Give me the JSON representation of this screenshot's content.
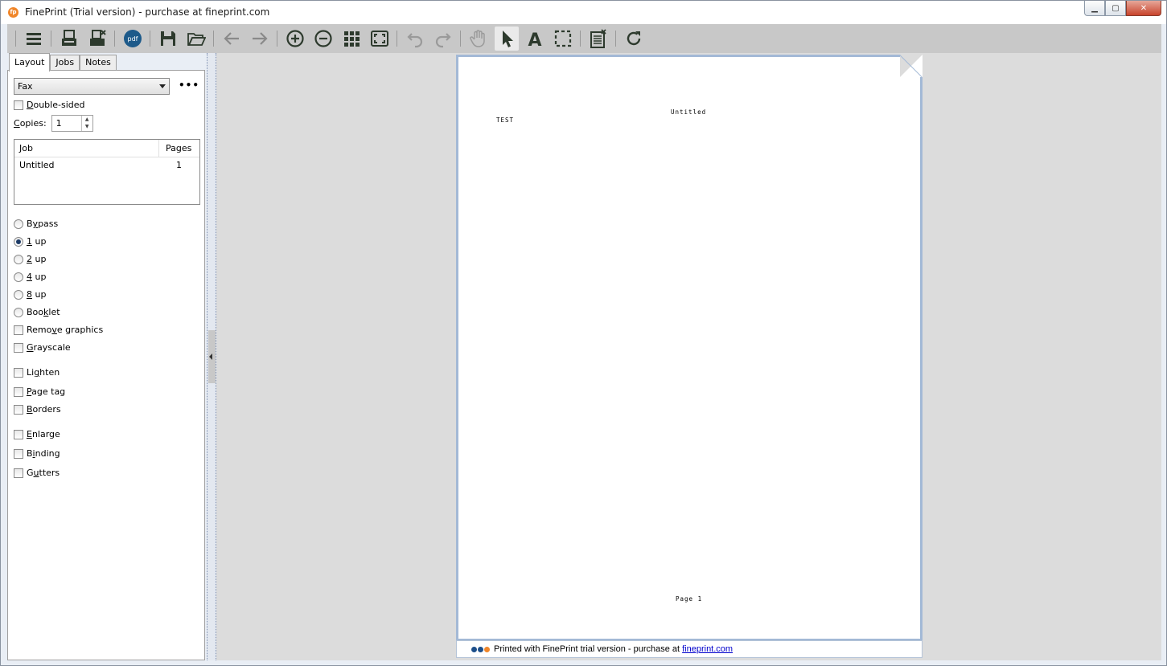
{
  "window": {
    "title": "FinePrint (Trial version) - purchase at fineprint.com",
    "app_icon_text": "fp",
    "buttons": {
      "minimize": "▭",
      "maximize": "▢",
      "close": "✕"
    }
  },
  "toolbar": {
    "items": [
      {
        "name": "menu",
        "icon": "hamburger-icon"
      },
      {
        "name": "print",
        "icon": "printer-icon"
      },
      {
        "name": "print-delete",
        "icon": "printer-delete-icon"
      },
      {
        "name": "pdf",
        "icon": "pdf-icon",
        "label": "pdf"
      },
      {
        "name": "save",
        "icon": "save-icon"
      },
      {
        "name": "open",
        "icon": "folder-open-icon"
      },
      {
        "name": "back",
        "icon": "arrow-left-icon"
      },
      {
        "name": "forward",
        "icon": "arrow-right-icon"
      },
      {
        "name": "zoom-in",
        "icon": "zoom-in-icon"
      },
      {
        "name": "zoom-out",
        "icon": "zoom-out-icon"
      },
      {
        "name": "thumbnails",
        "icon": "grid-icon"
      },
      {
        "name": "fit-page",
        "icon": "fit-icon"
      },
      {
        "name": "undo",
        "icon": "undo-icon"
      },
      {
        "name": "redo",
        "icon": "redo-icon"
      },
      {
        "name": "pan",
        "icon": "hand-icon"
      },
      {
        "name": "select",
        "icon": "pointer-icon"
      },
      {
        "name": "text",
        "icon": "text-icon"
      },
      {
        "name": "area-select",
        "icon": "marquee-icon"
      },
      {
        "name": "delete-page",
        "icon": "page-delete-icon"
      },
      {
        "name": "refresh",
        "icon": "refresh-icon"
      }
    ]
  },
  "tabs": [
    {
      "label": "Layout",
      "active": true
    },
    {
      "label": "Jobs",
      "active": false
    },
    {
      "label": "Notes",
      "active": false
    }
  ],
  "layout_panel": {
    "printer_select": "Fax",
    "more_button": "•••",
    "double_sided": {
      "label_u": "D",
      "label_rest": "ouble-sided",
      "checked": false
    },
    "copies": {
      "label_u": "C",
      "label_rest": "opies:",
      "value": "1"
    },
    "job_table": {
      "headers": [
        "Job",
        "Pages"
      ],
      "rows": [
        {
          "job": "Untitled",
          "pages": "1"
        }
      ]
    },
    "radios": [
      {
        "pre": "B",
        "u": "y",
        "post": "pass",
        "checked": false
      },
      {
        "pre": "",
        "u": "1",
        "post": " up",
        "checked": true
      },
      {
        "pre": "",
        "u": "2",
        "post": " up",
        "checked": false
      },
      {
        "pre": "",
        "u": "4",
        "post": " up",
        "checked": false
      },
      {
        "pre": "",
        "u": "8",
        "post": " up",
        "checked": false
      },
      {
        "pre": "Boo",
        "u": "k",
        "post": "let",
        "checked": false
      }
    ],
    "checkboxes": [
      {
        "pre": "Remo",
        "u": "v",
        "post": "e graphics",
        "checked": false
      },
      {
        "pre": "",
        "u": "G",
        "post": "rayscale",
        "checked": false
      },
      {
        "pre": "Li",
        "u": "g",
        "post": "hten",
        "checked": false
      },
      {
        "pre": "",
        "u": "P",
        "post": "age tag",
        "checked": false
      },
      {
        "pre": "",
        "u": "B",
        "post": "orders",
        "checked": false
      },
      {
        "pre": "",
        "u": "E",
        "post": "nlarge",
        "checked": false
      },
      {
        "pre": "B",
        "u": "i",
        "post": "nding",
        "checked": false
      },
      {
        "pre": "G",
        "u": "u",
        "post": "tters",
        "checked": false
      }
    ]
  },
  "preview": {
    "header_text": "Untitled",
    "body_text": "TEST",
    "footer_text": "Page  1",
    "trial_notice": "Printed with FinePrint trial version - purchase at",
    "trial_link": "fineprint.com",
    "dot_colors": [
      "#1d4f8a",
      "#1d4f8a",
      "#f0862a"
    ]
  }
}
